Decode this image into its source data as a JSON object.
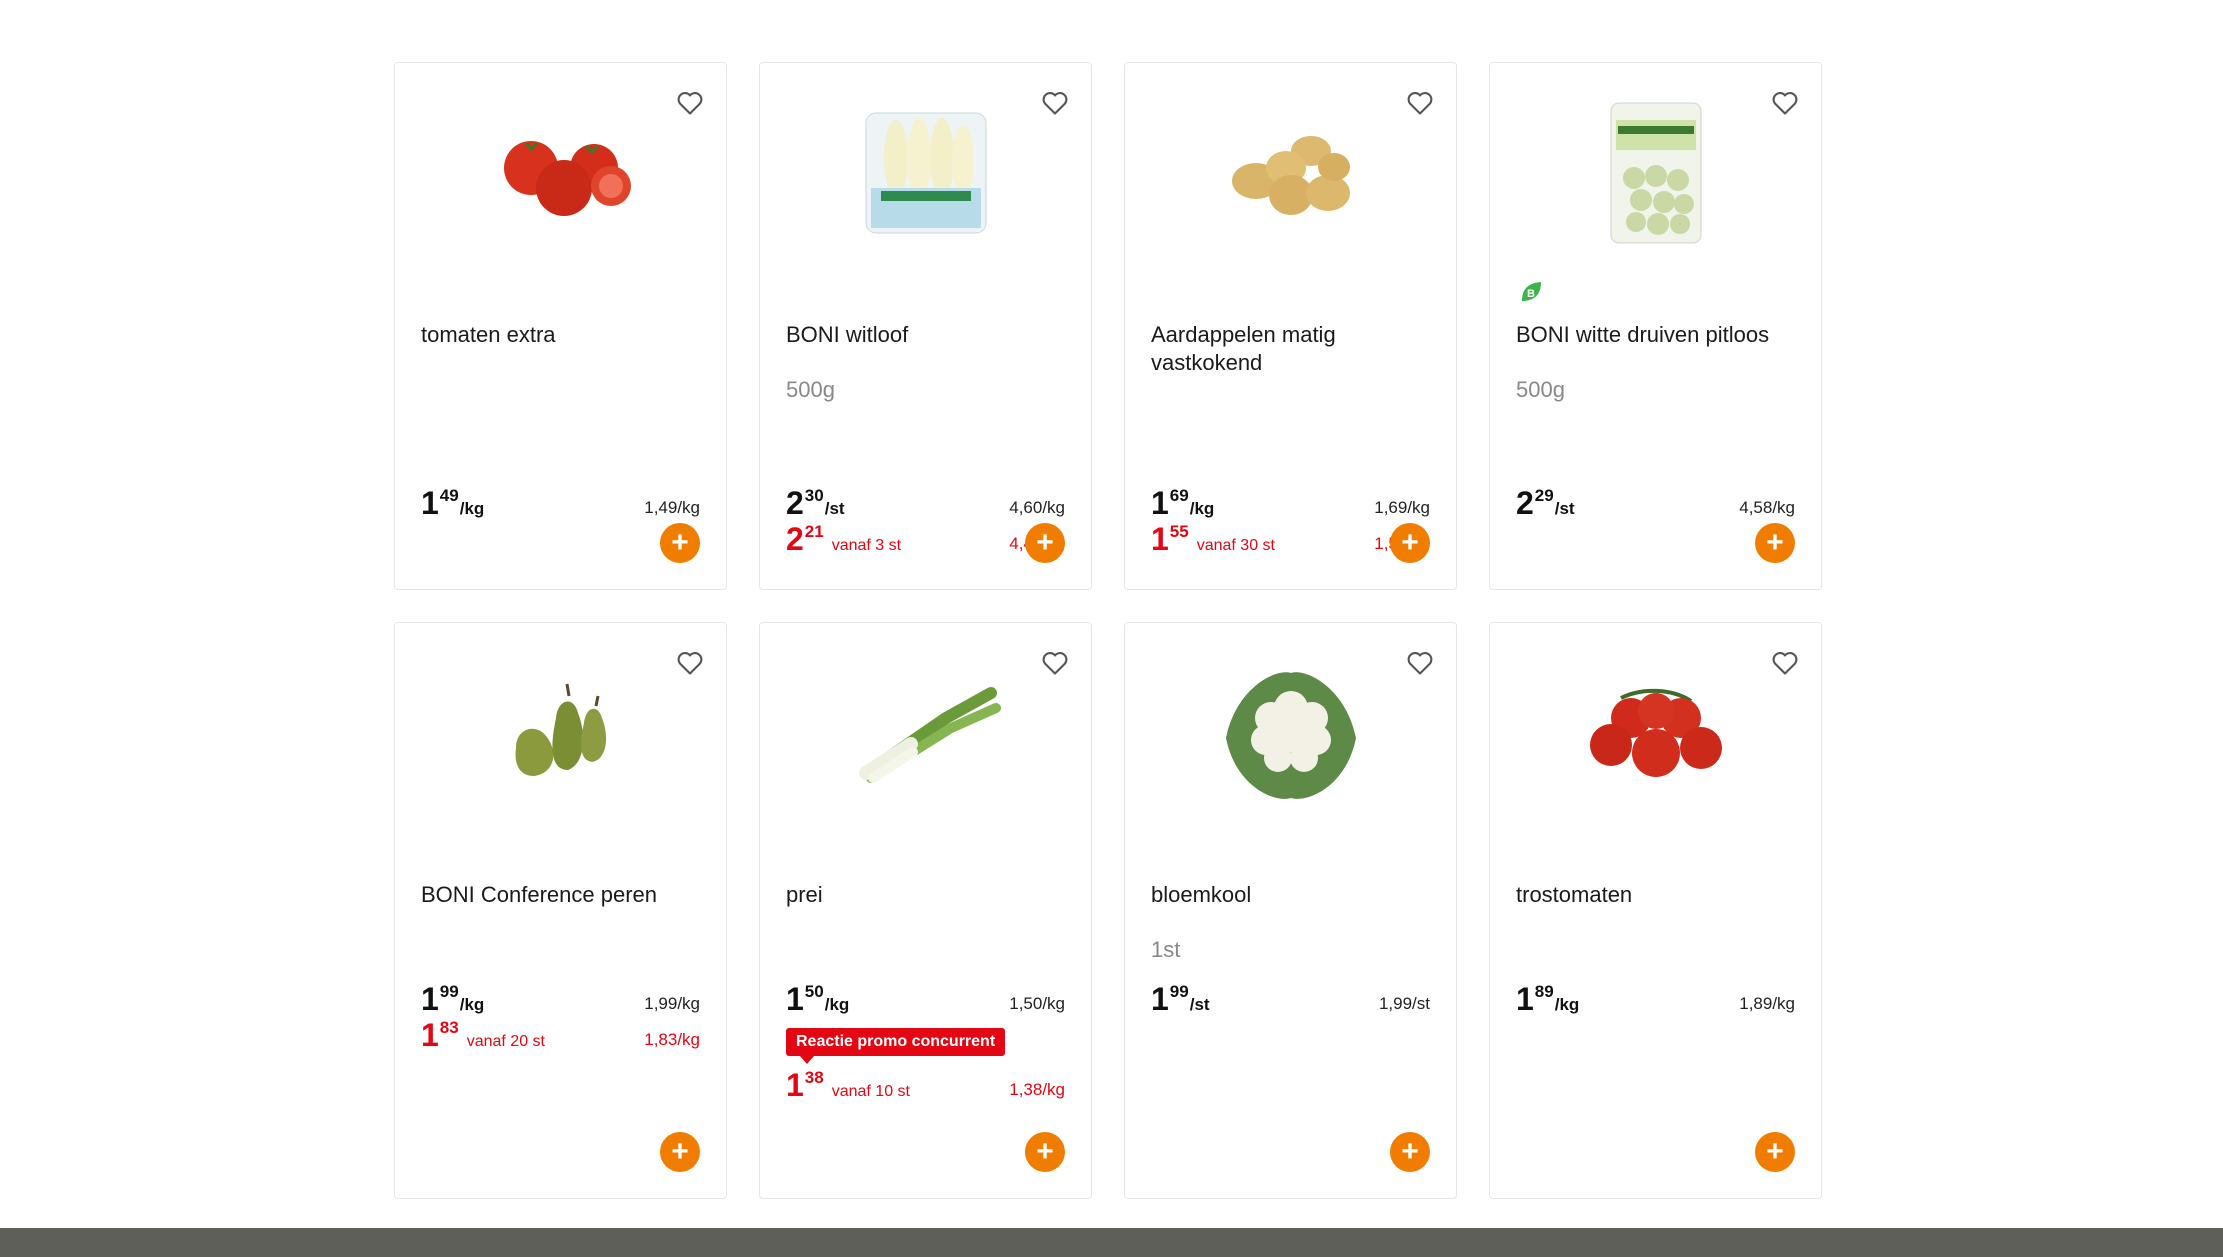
{
  "products": [
    {
      "name": "tomaten extra",
      "weight": "",
      "price_int": "1",
      "price_dec": "49",
      "price_unit": "/kg",
      "per_kg": "1,49/kg",
      "promo": null,
      "badge": "",
      "image_icon": "tomatoes-image"
    },
    {
      "name": "BONI witloof",
      "weight": "500g",
      "price_int": "2",
      "price_dec": "30",
      "price_unit": "/st",
      "per_kg": "4,60/kg",
      "promo": {
        "int": "2",
        "dec": "21",
        "from": "vanaf 3 st",
        "per_kg": "4,42/kg"
      },
      "badge": "",
      "image_icon": "chicory-image"
    },
    {
      "name": "Aardappelen matig vastkokend",
      "weight": "",
      "price_int": "1",
      "price_dec": "69",
      "price_unit": "/kg",
      "per_kg": "1,69/kg",
      "promo": {
        "int": "1",
        "dec": "55",
        "from": "vanaf 30 st",
        "per_kg": "1,55/kg"
      },
      "badge": "",
      "image_icon": "potatoes-image"
    },
    {
      "name": "BONI witte druiven pitloos",
      "weight": "500g",
      "price_int": "2",
      "price_dec": "29",
      "price_unit": "/st",
      "per_kg": "4,58/kg",
      "promo": null,
      "badge": "",
      "bio": "B",
      "image_icon": "grapes-image"
    },
    {
      "name": "BONI Conference peren",
      "weight": "",
      "price_int": "1",
      "price_dec": "99",
      "price_unit": "/kg",
      "per_kg": "1,99/kg",
      "promo": {
        "int": "1",
        "dec": "83",
        "from": "vanaf 20 st",
        "per_kg": "1,83/kg"
      },
      "badge": "",
      "image_icon": "pears-image"
    },
    {
      "name": "prei",
      "weight": "",
      "price_int": "1",
      "price_dec": "50",
      "price_unit": "/kg",
      "per_kg": "1,50/kg",
      "promo": {
        "int": "1",
        "dec": "38",
        "from": "vanaf 10 st",
        "per_kg": "1,38/kg"
      },
      "badge": "Reactie promo concurrent",
      "image_icon": "leek-image"
    },
    {
      "name": "bloemkool",
      "weight": "1st",
      "price_int": "1",
      "price_dec": "99",
      "price_unit": "/st",
      "per_kg": "1,99/st",
      "promo": null,
      "badge": "",
      "image_icon": "cauliflower-image"
    },
    {
      "name": "trostomaten",
      "weight": "",
      "price_int": "1",
      "price_dec": "89",
      "price_unit": "/kg",
      "per_kg": "1,89/kg",
      "promo": null,
      "badge": "",
      "image_icon": "vine-tomatoes-image"
    }
  ],
  "add_label": "+",
  "colors": {
    "accent": "#f07d00",
    "promo": "#e30613",
    "bio": "#3cb44b"
  }
}
